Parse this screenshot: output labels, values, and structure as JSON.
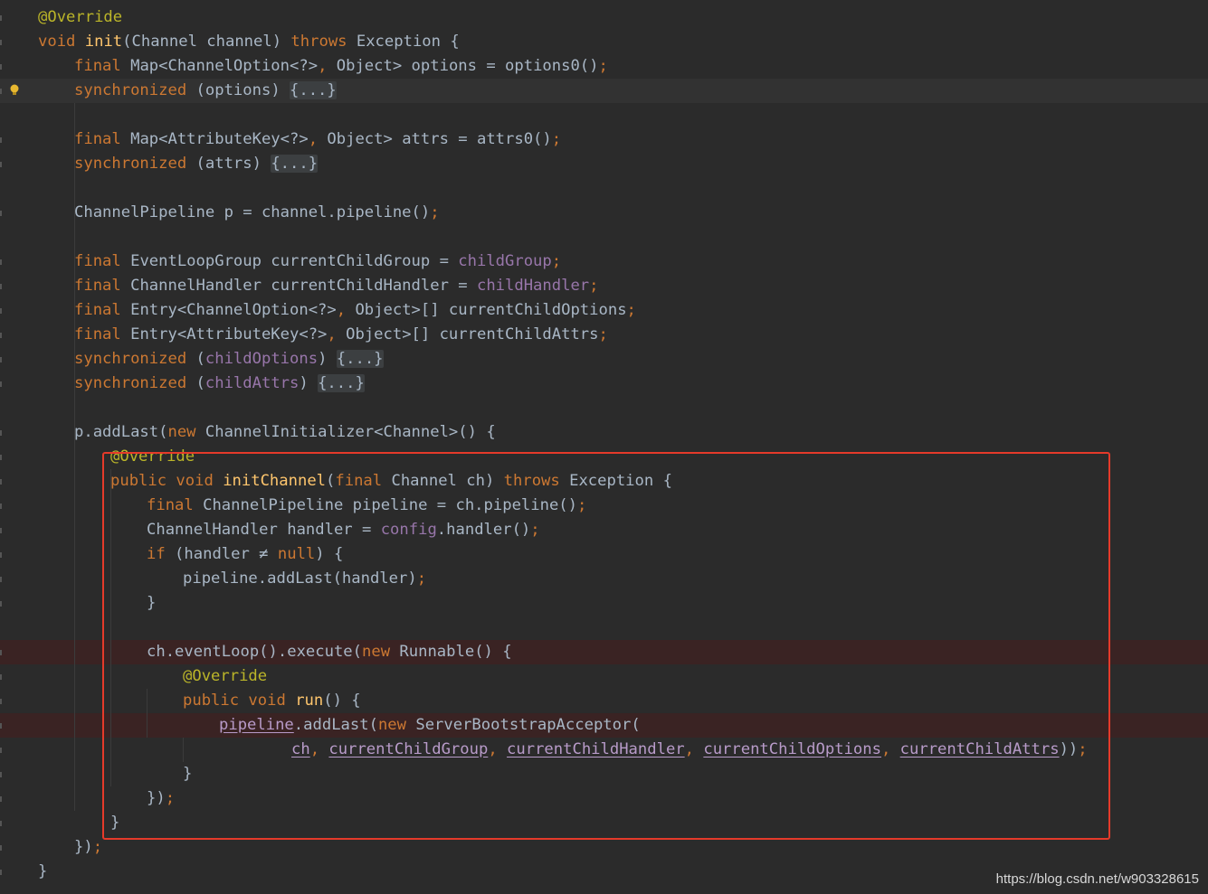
{
  "editor": {
    "language": "java",
    "colors": {
      "background": "#2b2b2b",
      "keyword": "#cc7832",
      "annotation": "#bbb529",
      "method_declaration": "#ffc66d",
      "field": "#9876aa",
      "plain": "#a9b7c6",
      "highlight_box": "#e53a2a",
      "breakpoint_line": "#3a2323"
    },
    "lines": [
      {
        "indent": 0,
        "tokens": [
          [
            "ann",
            "@Override"
          ]
        ]
      },
      {
        "indent": 0,
        "tokens": [
          [
            "kw",
            "void "
          ],
          [
            "fn",
            "init"
          ],
          [
            "txt",
            "(Channel channel) "
          ],
          [
            "kw",
            "throws "
          ],
          [
            "txt",
            "Exception {"
          ]
        ]
      },
      {
        "indent": 1,
        "tokens": [
          [
            "kw",
            "final "
          ],
          [
            "txt",
            "Map<ChannelOption<?>"
          ],
          [
            "kw",
            ", "
          ],
          [
            "txt",
            "Object> options = options0()"
          ],
          [
            "kw",
            ";"
          ]
        ]
      },
      {
        "indent": 1,
        "caret": true,
        "bulb": true,
        "tokens": [
          [
            "kw",
            "synchronized "
          ],
          [
            "txt",
            "(options) "
          ],
          [
            "fold",
            "{...}"
          ]
        ]
      },
      {
        "indent": 0,
        "tokens": []
      },
      {
        "indent": 1,
        "tokens": [
          [
            "kw",
            "final "
          ],
          [
            "txt",
            "Map<AttributeKey<?>"
          ],
          [
            "kw",
            ", "
          ],
          [
            "txt",
            "Object> attrs = attrs0()"
          ],
          [
            "kw",
            ";"
          ]
        ]
      },
      {
        "indent": 1,
        "tokens": [
          [
            "kw",
            "synchronized "
          ],
          [
            "txt",
            "(attrs) "
          ],
          [
            "fold",
            "{...}"
          ]
        ]
      },
      {
        "indent": 0,
        "tokens": []
      },
      {
        "indent": 1,
        "tokens": [
          [
            "txt",
            "ChannelPipeline p = channel.pipeline()"
          ],
          [
            "kw",
            ";"
          ]
        ]
      },
      {
        "indent": 0,
        "tokens": []
      },
      {
        "indent": 1,
        "tokens": [
          [
            "kw",
            "final "
          ],
          [
            "txt",
            "EventLoopGroup currentChildGroup = "
          ],
          [
            "fld",
            "childGroup"
          ],
          [
            "kw",
            ";"
          ]
        ]
      },
      {
        "indent": 1,
        "tokens": [
          [
            "kw",
            "final "
          ],
          [
            "txt",
            "ChannelHandler currentChildHandler = "
          ],
          [
            "fld",
            "childHandler"
          ],
          [
            "kw",
            ";"
          ]
        ]
      },
      {
        "indent": 1,
        "tokens": [
          [
            "kw",
            "final "
          ],
          [
            "txt",
            "Entry<ChannelOption<?>"
          ],
          [
            "kw",
            ", "
          ],
          [
            "txt",
            "Object>[] currentChildOptions"
          ],
          [
            "kw",
            ";"
          ]
        ]
      },
      {
        "indent": 1,
        "tokens": [
          [
            "kw",
            "final "
          ],
          [
            "txt",
            "Entry<AttributeKey<?>"
          ],
          [
            "kw",
            ", "
          ],
          [
            "txt",
            "Object>[] currentChildAttrs"
          ],
          [
            "kw",
            ";"
          ]
        ]
      },
      {
        "indent": 1,
        "tokens": [
          [
            "kw",
            "synchronized "
          ],
          [
            "txt",
            "("
          ],
          [
            "fld",
            "childOptions"
          ],
          [
            "txt",
            ") "
          ],
          [
            "fold",
            "{...}"
          ]
        ]
      },
      {
        "indent": 1,
        "tokens": [
          [
            "kw",
            "synchronized "
          ],
          [
            "txt",
            "("
          ],
          [
            "fld",
            "childAttrs"
          ],
          [
            "txt",
            ") "
          ],
          [
            "fold",
            "{...}"
          ]
        ]
      },
      {
        "indent": 0,
        "tokens": []
      },
      {
        "indent": 1,
        "tokens": [
          [
            "txt",
            "p.addLast("
          ],
          [
            "kw",
            "new "
          ],
          [
            "txt",
            "ChannelInitializer<Channel>() {"
          ]
        ]
      },
      {
        "indent": 2,
        "tokens": [
          [
            "ann",
            "@Override"
          ]
        ]
      },
      {
        "indent": 2,
        "tokens": [
          [
            "kw",
            "public void "
          ],
          [
            "fn",
            "initChannel"
          ],
          [
            "txt",
            "("
          ],
          [
            "kw",
            "final "
          ],
          [
            "txt",
            "Channel ch) "
          ],
          [
            "kw",
            "throws "
          ],
          [
            "txt",
            "Exception {"
          ]
        ]
      },
      {
        "indent": 3,
        "tokens": [
          [
            "kw",
            "final "
          ],
          [
            "txt",
            "ChannelPipeline pipeline = ch.pipeline()"
          ],
          [
            "kw",
            ";"
          ]
        ]
      },
      {
        "indent": 3,
        "tokens": [
          [
            "txt",
            "ChannelHandler handler = "
          ],
          [
            "fld",
            "config"
          ],
          [
            "txt",
            ".handler()"
          ],
          [
            "kw",
            ";"
          ]
        ]
      },
      {
        "indent": 3,
        "tokens": [
          [
            "kw",
            "if "
          ],
          [
            "txt",
            "(handler ≠ "
          ],
          [
            "kw",
            "null"
          ],
          [
            "txt",
            ") {"
          ]
        ]
      },
      {
        "indent": 4,
        "tokens": [
          [
            "txt",
            "pipeline.addLast(handler)"
          ],
          [
            "kw",
            ";"
          ]
        ]
      },
      {
        "indent": 3,
        "tokens": [
          [
            "txt",
            "}"
          ]
        ]
      },
      {
        "indent": 0,
        "tokens": []
      },
      {
        "indent": 3,
        "breakpoint": true,
        "tokens": [
          [
            "txt",
            "ch.eventLoop().execute("
          ],
          [
            "kw",
            "new "
          ],
          [
            "txt",
            "Runnable() {"
          ]
        ]
      },
      {
        "indent": 4,
        "tokens": [
          [
            "ann",
            "@Override"
          ]
        ]
      },
      {
        "indent": 4,
        "tokens": [
          [
            "kw",
            "public void "
          ],
          [
            "fn",
            "run"
          ],
          [
            "txt",
            "() {"
          ]
        ]
      },
      {
        "indent": 5,
        "breakpoint": true,
        "tokens": [
          [
            "cap",
            "pipeline"
          ],
          [
            "txt",
            ".addLast("
          ],
          [
            "kw",
            "new "
          ],
          [
            "txt",
            "ServerBootstrapAcceptor("
          ]
        ]
      },
      {
        "indent": 7,
        "tokens": [
          [
            "cap",
            "ch"
          ],
          [
            "kw",
            ", "
          ],
          [
            "cap",
            "currentChildGroup"
          ],
          [
            "kw",
            ", "
          ],
          [
            "cap",
            "currentChildHandler"
          ],
          [
            "kw",
            ", "
          ],
          [
            "cap",
            "currentChildOptions"
          ],
          [
            "kw",
            ", "
          ],
          [
            "cap",
            "currentChildAttrs"
          ],
          [
            "txt",
            "))"
          ],
          [
            "kw",
            ";"
          ]
        ]
      },
      {
        "indent": 4,
        "tokens": [
          [
            "txt",
            "}"
          ]
        ]
      },
      {
        "indent": 3,
        "tokens": [
          [
            "txt",
            "})"
          ],
          [
            "kw",
            ";"
          ]
        ]
      },
      {
        "indent": 2,
        "tokens": [
          [
            "txt",
            "}"
          ]
        ]
      },
      {
        "indent": 1,
        "tokens": [
          [
            "txt",
            "})"
          ],
          [
            "kw",
            ";"
          ]
        ]
      },
      {
        "indent": 0,
        "tokens": [
          [
            "txt",
            "}"
          ]
        ]
      }
    ]
  },
  "watermark": "https://blog.csdn.net/w903328615"
}
